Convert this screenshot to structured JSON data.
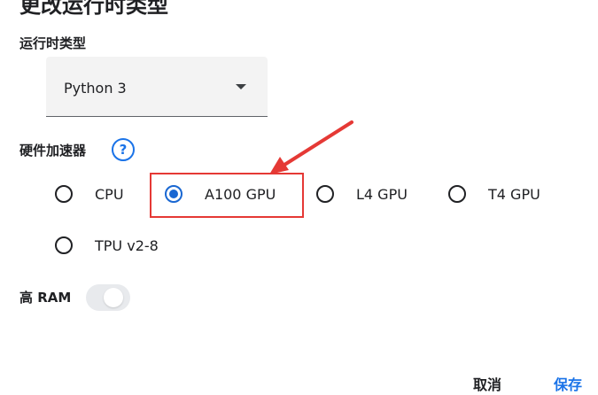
{
  "dialog": {
    "title": "更改运行时类型"
  },
  "runtime": {
    "label": "运行时类型",
    "selected": "Python 3"
  },
  "hardware": {
    "label": "硬件加速器",
    "help_glyph": "?",
    "options": [
      {
        "label": "CPU",
        "checked": false
      },
      {
        "label": "A100 GPU",
        "checked": true
      },
      {
        "label": "L4 GPU",
        "checked": false
      },
      {
        "label": "T4 GPU",
        "checked": false
      },
      {
        "label": "TPU v2-8",
        "checked": false
      }
    ]
  },
  "high_ram": {
    "label": "高 RAM",
    "enabled": false
  },
  "actions": {
    "cancel_label": "取消",
    "save_label": "保存"
  },
  "colors": {
    "accent": "#1a73e8",
    "annotation": "#e53935"
  }
}
